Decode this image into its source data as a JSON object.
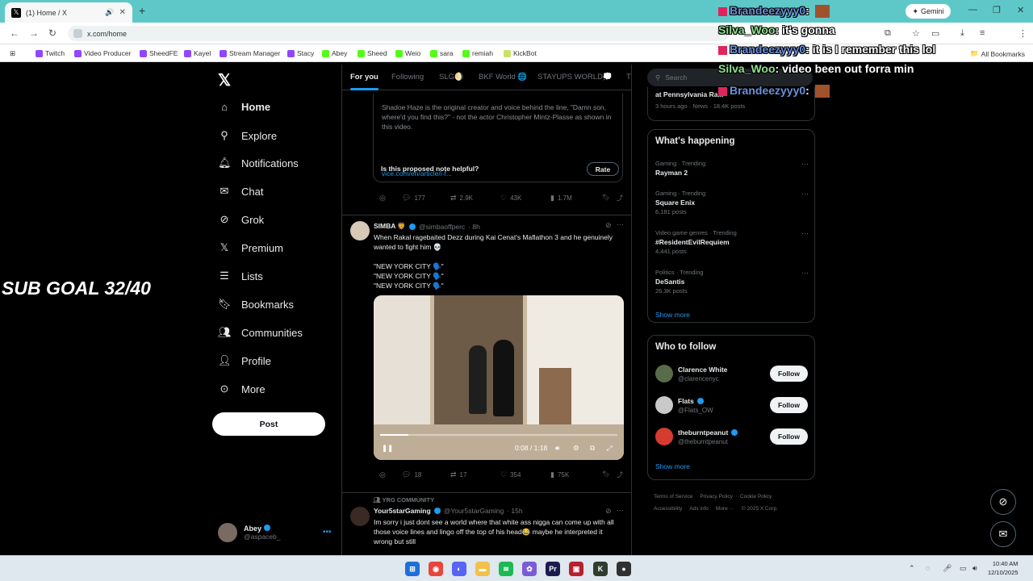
{
  "browser": {
    "tab_title": "(1) Home / X",
    "url": "x.com/home",
    "gemini_label": "Gemini",
    "bookmarks": [
      "Twitch",
      "Video Producer",
      "SheedFE",
      "Kayel",
      "Stream Manager",
      "Stacy",
      "Abey",
      "Sheed",
      "Weio",
      "sara",
      "remiah",
      "KickBot"
    ],
    "all_bookmarks": "All Bookmarks"
  },
  "leftnav": {
    "items": [
      {
        "label": "Home",
        "icon": "home-icon"
      },
      {
        "label": "Explore",
        "icon": "search-icon"
      },
      {
        "label": "Notifications",
        "icon": "bell-icon"
      },
      {
        "label": "Chat",
        "icon": "mail-icon"
      },
      {
        "label": "Grok",
        "icon": "grok-icon"
      },
      {
        "label": "Premium",
        "icon": "x-icon"
      },
      {
        "label": "Lists",
        "icon": "list-icon"
      },
      {
        "label": "Bookmarks",
        "icon": "bookmark-icon"
      },
      {
        "label": "Communities",
        "icon": "communities-icon"
      },
      {
        "label": "Profile",
        "icon": "person-icon"
      },
      {
        "label": "More",
        "icon": "more-icon"
      }
    ],
    "post_label": "Post",
    "account": {
      "name": "Abey",
      "handle": "@aspaceb_"
    }
  },
  "feed": {
    "tabs": [
      "For you",
      "Following",
      "SLG🌖",
      "BKF World 🌐",
      "STAYUPS WORLD💭",
      "TI"
    ],
    "note_text": "Shadoe Haze is the original creator and voice behind the line, \"Damn son, where'd you find this?\" - not the actor Christopher Mintz-Plasse as shown in this video.",
    "note_link": "vice.com/en/article/i-f...",
    "helpful_q": "Is this proposed note helpful?",
    "rate_label": "Rate",
    "actions1": {
      "replies": "177",
      "reposts": "2.9K",
      "likes": "43K",
      "views": "1.7M"
    },
    "tweet2": {
      "name": "SIMBA 🦁",
      "handle": "@simbaoffperc",
      "time": "· 8h",
      "text1": "When Rakal ragebaited Dezz during Kai Cenat's Maflathon 3 and he genuinely wanted to fight him 💀",
      "lines": [
        "\"NEW YORK CITY 🗣️\"",
        "\"NEW YORK CITY 🗣️\"",
        "\"NEW YORK CITY 🗣️\""
      ],
      "video_time": "0:08 / 1:18",
      "actions": {
        "replies": "18",
        "reposts": "17",
        "likes": "354",
        "views": "75K"
      }
    },
    "tweet3": {
      "group": "YRG COMMUNITY",
      "name": "Your5starGaming",
      "handle": "@Your5starGaming",
      "time": "· 15h",
      "text": "Im sorry i just dont see a world where that white ass nigga can come up with all those voice lines and lingo off the top of his head😂 maybe he interpreted it wrong but still"
    }
  },
  "right": {
    "search_placeholder": "Search",
    "top_title": "at Pennsylvania Ra...",
    "top_meta": "3 hours ago · News · 18.4K posts",
    "happening_title": "What's happening",
    "trends": [
      {
        "cat": "Gaming · Trending",
        "name": "Rayman 2",
        "count": ""
      },
      {
        "cat": "Gaming · Trending",
        "name": "Square Enix",
        "count": "6,181 posts"
      },
      {
        "cat": "Video game genres · Trending",
        "name": "#ResidentEvilRequiem",
        "count": "4,441 posts"
      },
      {
        "cat": "Politics · Trending",
        "name": "DeSantis",
        "count": "26.3K posts"
      }
    ],
    "show_more": "Show more",
    "wtf_title": "Who to follow",
    "follows": [
      {
        "name": "Clarence White",
        "handle": "@clarencenyc",
        "verified": false
      },
      {
        "name": "Flats",
        "handle": "@Flats_OW",
        "verified": true
      },
      {
        "name": "theburntpeanut",
        "handle": "@theburntpeanut",
        "verified": true
      }
    ],
    "follow_label": "Follow",
    "footer": [
      "Terms of Service",
      "Privacy Policy",
      "Cookie Policy",
      "Accessibility",
      "Ads info",
      "More ···",
      "© 2025 X Corp."
    ]
  },
  "overlay": {
    "subgoal": "SUB GOAL 32/40",
    "chat": [
      {
        "user": "Brandeezyyy0",
        "msg": "",
        "color": "#6a8fd9"
      },
      {
        "user": "Silva_Woo",
        "msg": "it's gonna",
        "color": "#8ee08e"
      },
      {
        "user": "Brandeezyyy0",
        "msg": "it is I remember this lol",
        "color": "#6a8fd9"
      },
      {
        "user": "Silva_Woo",
        "msg": "video been out forra min",
        "color": "#8ee08e"
      },
      {
        "user": "Brandeezyyy0",
        "msg": "",
        "color": "#6a8fd9"
      }
    ]
  },
  "taskbar": {
    "time": "10:40 AM",
    "date": "12/10/2025"
  }
}
